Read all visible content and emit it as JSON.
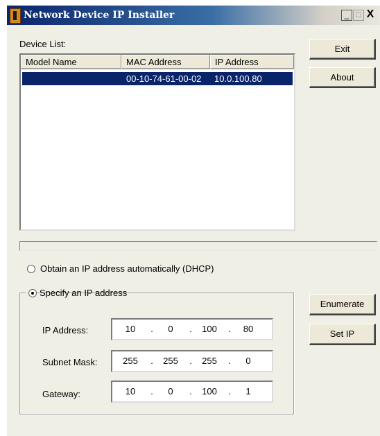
{
  "window": {
    "title": "Network Device IP Installer"
  },
  "titlebar": {
    "minimize": "_",
    "maximize": "□",
    "close": "X"
  },
  "device_list": {
    "label": "Device List:",
    "columns": [
      "Model Name",
      "MAC Address",
      "IP Address"
    ],
    "rows": [
      {
        "model": "",
        "mac": "00-10-74-61-00-02",
        "ip": "10.0.100.80",
        "selected": true
      }
    ]
  },
  "buttons": {
    "exit": "Exit",
    "about": "About",
    "enumerate": "Enumerate",
    "set_ip": "Set IP"
  },
  "options": {
    "dhcp_label": "Obtain an IP address automatically (DHCP)",
    "dhcp_selected": false,
    "static_label": "Specify an IP address",
    "static_selected": true
  },
  "fields": {
    "ip_label": "IP Address:",
    "ip": [
      "10",
      "0",
      "100",
      "80"
    ],
    "subnet_label": "Subnet Mask:",
    "subnet": [
      "255",
      "255",
      "255",
      "0"
    ],
    "gateway_label": "Gateway:",
    "gateway": [
      "10",
      "0",
      "100",
      "1"
    ],
    "dot": "."
  },
  "colors": {
    "selection": "#0a246a",
    "title_bar": "#0a246a",
    "face": "#ece9d8"
  }
}
